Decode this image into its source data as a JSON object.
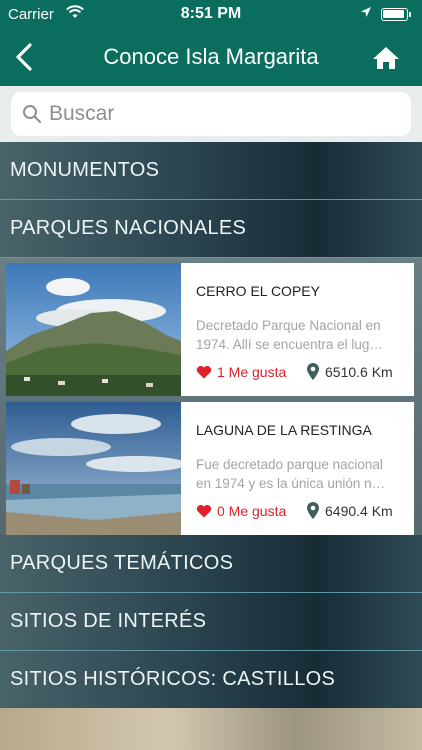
{
  "status_bar": {
    "carrier": "Carrier",
    "time": "8:51 PM"
  },
  "header": {
    "title": "Conoce Isla Margarita",
    "back_icon": "chevron-left-icon",
    "home_icon": "home-icon"
  },
  "search": {
    "placeholder": "Buscar"
  },
  "categories": [
    {
      "label": "MONUMENTOS"
    },
    {
      "label": "PARQUES NACIONALES"
    },
    {
      "label": "PARQUES TEMÁTICOS"
    },
    {
      "label": "SITIOS DE INTERÉS"
    },
    {
      "label": "SITIOS HISTÓRICOS: CASTILLOS"
    }
  ],
  "items": [
    {
      "title": "CERRO EL COPEY",
      "desc_line1": "Decretado Parque Nacional en",
      "desc_line2": "1974. Allí se encuentra el lug…",
      "likes": "1 Me gusta",
      "distance": "6510.6 Km"
    },
    {
      "title": "LAGUNA DE LA RESTINGA",
      "desc_line1": "Fue decretado parque nacional",
      "desc_line2": "en 1974 y es la única unión n…",
      "likes": "0 Me gusta",
      "distance": "6490.4 Km"
    }
  ],
  "colors": {
    "header": "#0a6d5e",
    "like": "#e0202a"
  }
}
